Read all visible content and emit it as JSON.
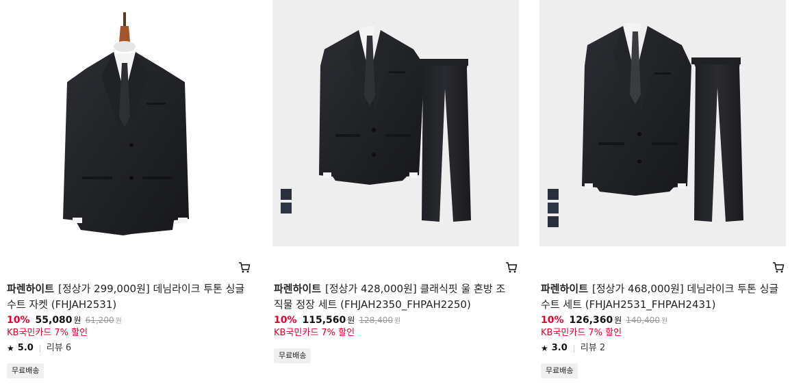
{
  "products": [
    {
      "brand": "파렌하이트",
      "name": "[정상가 299,000원] 데님라이크 투톤 싱글 수트 자켓 (FHJAH2531)",
      "discount": "10%",
      "sale_price": "55,080",
      "currency": "원",
      "original_price": "61,200",
      "card_discount": "KB국민카드 7% 할인",
      "rating": "5.0",
      "reviews": "리뷰 6",
      "badge": "무료배송",
      "image": "jacket-on-mannequin",
      "swatch_colors": []
    },
    {
      "brand": "파렌하이트",
      "name": "[정상가 428,000원] 클래식핏 울 혼방 조직물 정장 세트 (FHJAH2350_FHPAH2250)",
      "discount": "10%",
      "sale_price": "115,560",
      "currency": "원",
      "original_price": "128,400",
      "card_discount": "KB국민카드 7% 할인",
      "rating": "",
      "reviews": "",
      "badge": "무료배송",
      "image": "suit-set-jacket-and-pants",
      "swatch_colors": [
        "#2a2f3b",
        "#2c3445"
      ]
    },
    {
      "brand": "파렌하이트",
      "name": "[정상가 468,000원] 데님라이크 투톤 싱글 수트 세트 (FHJAH2531_FHPAH2431)",
      "discount": "10%",
      "sale_price": "126,360",
      "currency": "원",
      "original_price": "140,400",
      "card_discount": "KB국민카드 7% 할인",
      "rating": "3.0",
      "reviews": "리뷰 2",
      "badge": "무료배송",
      "image": "suit-set-jacket-and-pants",
      "swatch_colors": [
        "#2a2f3b",
        "#2f3441",
        "#2a2f3b"
      ]
    }
  ],
  "icons": {
    "cart": "cart-icon",
    "star": "star-icon"
  },
  "colors": {
    "discount": "#e4002b",
    "card_discount": "#e4002b",
    "badge_bg": "#f0f0f0",
    "thumb_gray": "#eeeeee"
  }
}
